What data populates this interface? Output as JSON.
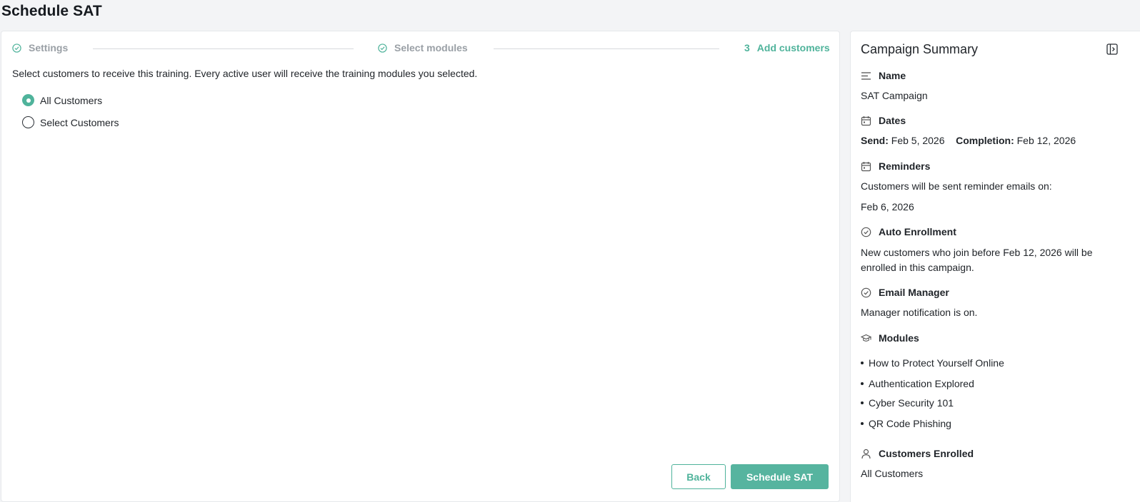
{
  "page": {
    "title": "Schedule SAT"
  },
  "stepper": {
    "steps": [
      {
        "label": "Settings",
        "state": "done"
      },
      {
        "label": "Select modules",
        "state": "done"
      },
      {
        "number": "3",
        "label": "Add customers",
        "state": "active"
      }
    ]
  },
  "main": {
    "intro": "Select customers to receive this training. Every active user will receive the training modules you selected.",
    "options": [
      {
        "label": "All Customers",
        "checked": true
      },
      {
        "label": "Select Customers",
        "checked": false
      }
    ],
    "back_label": "Back",
    "schedule_label": "Schedule SAT"
  },
  "summary": {
    "title": "Campaign Summary",
    "name": {
      "heading": "Name",
      "value": "SAT Campaign"
    },
    "dates": {
      "heading": "Dates",
      "send_label": "Send:",
      "send_value": "Feb 5, 2026",
      "completion_label": "Completion:",
      "completion_value": "Feb 12, 2026"
    },
    "reminders": {
      "heading": "Reminders",
      "text": "Customers will be sent reminder emails on:",
      "date": "Feb 6, 2026"
    },
    "auto_enrollment": {
      "heading": "Auto Enrollment",
      "line1": "New customers who join before Feb 12, 2026 will be",
      "line2": "enrolled in this campaign."
    },
    "email_manager": {
      "heading": "Email Manager",
      "text": "Manager notification is on."
    },
    "modules": {
      "heading": "Modules",
      "items": [
        "How to Protect Yourself Online",
        "Authentication Explored",
        "Cyber Security 101",
        "QR Code Phishing"
      ]
    },
    "customers_enrolled": {
      "heading": "Customers Enrolled",
      "value": "All Customers"
    }
  },
  "colors": {
    "accent": "#56b49f",
    "accent_text": "#4fb39b",
    "muted": "#9aa0a6"
  }
}
